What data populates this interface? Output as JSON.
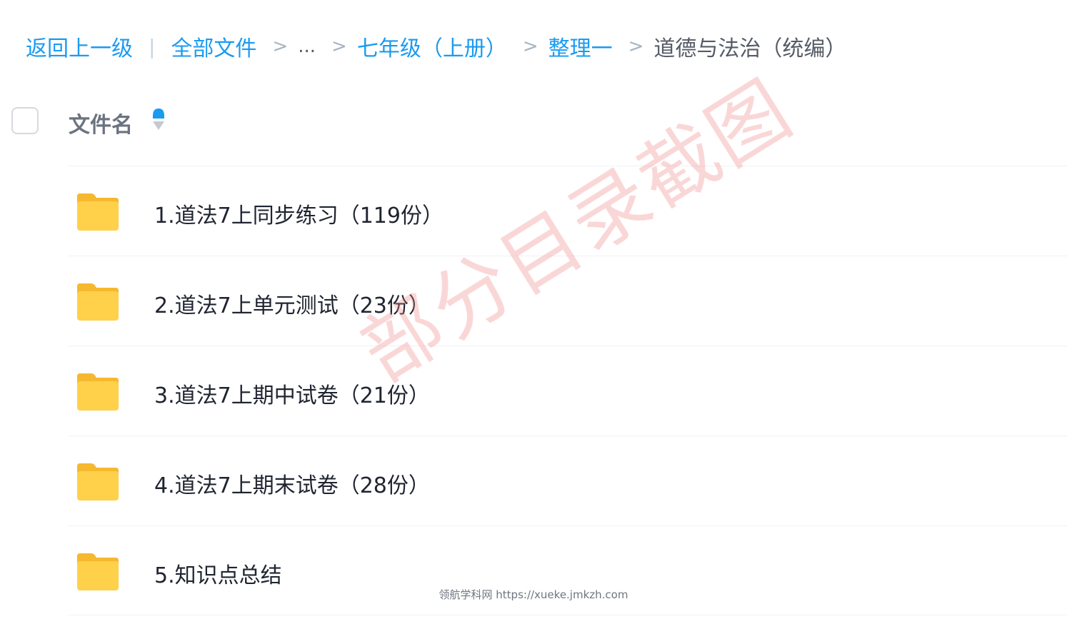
{
  "breadcrumb": {
    "back": "返回上一级",
    "divider": "|",
    "separator": ">",
    "items": [
      "全部文件",
      "...",
      "七年级（上册）",
      "整理一"
    ],
    "current": "道德与法治（统编）"
  },
  "header": {
    "column_title": "文件名"
  },
  "files": [
    {
      "name": "1.道法7上同步练习（119份）",
      "icon": "folder-icon"
    },
    {
      "name": "2.道法7上单元测试（23份）",
      "icon": "folder-icon"
    },
    {
      "name": "3.道法7上期中试卷（21份）",
      "icon": "folder-icon"
    },
    {
      "name": "4.道法7上期末试卷（28份）",
      "icon": "folder-icon"
    },
    {
      "name": "5.知识点总结",
      "icon": "folder-icon"
    }
  ],
  "watermark": "部分目录截图",
  "footer": "领航学科网 https://xueke.jmkzh.com",
  "colors": {
    "link": "#1a9bf0",
    "folder": "#ffc83d",
    "watermark": "#f08282"
  }
}
